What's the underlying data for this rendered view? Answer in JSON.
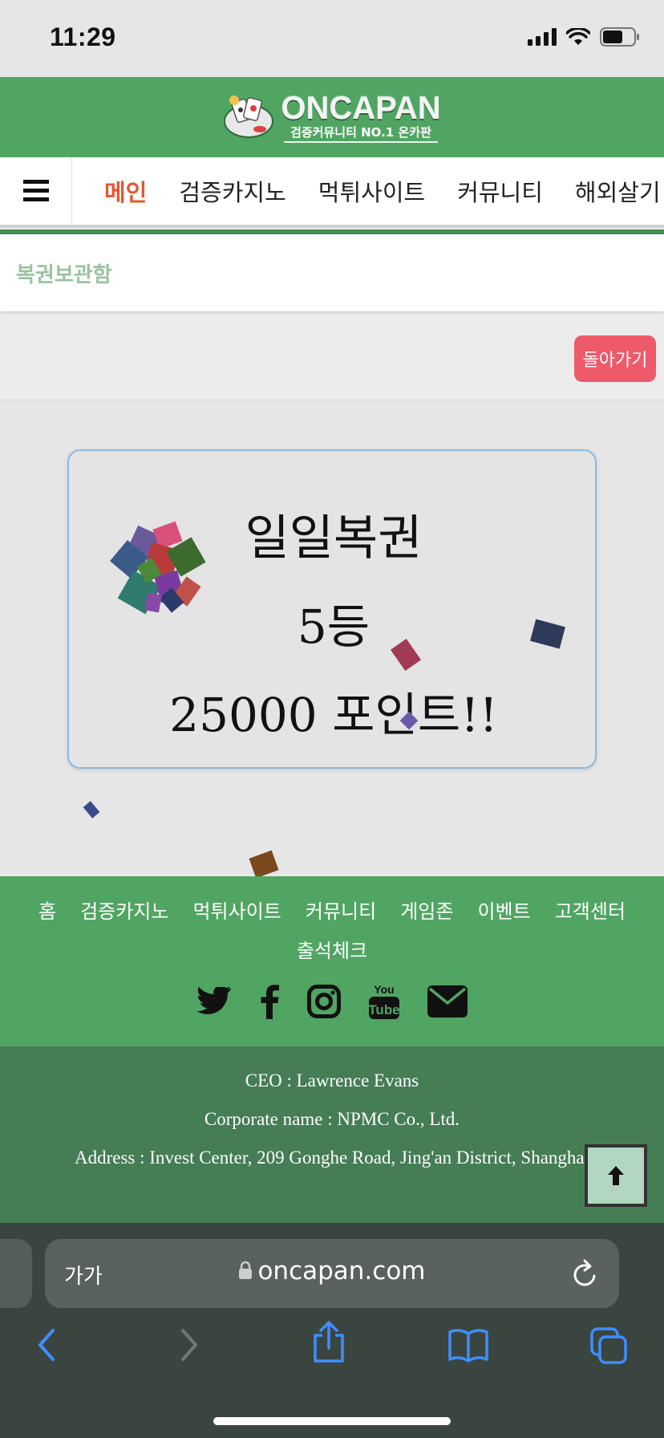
{
  "status_bar": {
    "time": "11:29"
  },
  "header": {
    "logo_text": "ONCAPAN",
    "logo_subtitle": "검증커뮤니티 NO.1 온카판"
  },
  "nav": {
    "items": [
      {
        "label": "메인",
        "active": true
      },
      {
        "label": "검증카지노"
      },
      {
        "label": "먹튀사이트"
      },
      {
        "label": "커뮤니티"
      },
      {
        "label": "해외살기"
      }
    ]
  },
  "breadcrumb": {
    "title": "복권보관함"
  },
  "back_button": {
    "label": "돌아가기"
  },
  "lottery": {
    "title": "일일복권",
    "rank": "5등",
    "prize": "25000 포인트!!"
  },
  "footer": {
    "links": [
      "홈",
      "검증카지노",
      "먹튀사이트",
      "커뮤니티",
      "게임존",
      "이벤트",
      "고객센터",
      "출석체크"
    ],
    "social_icons": [
      "twitter-icon",
      "facebook-icon",
      "instagram-icon",
      "youtube-icon",
      "mail-icon"
    ],
    "ceo": "CEO : Lawrence Evans",
    "corporate_name": "Corporate name : NPMC Co., Ltd.",
    "address": "Address : Invest Center, 209 Gonghe Road, Jing'an District, Shanghai"
  },
  "browser": {
    "text_size_button": "가가",
    "url": "oncapan.com"
  },
  "colors": {
    "header_green": "#51a563",
    "footer_dark_green": "#457d55",
    "accent_red": "#e4572e",
    "back_button": "#ee5a6a"
  }
}
